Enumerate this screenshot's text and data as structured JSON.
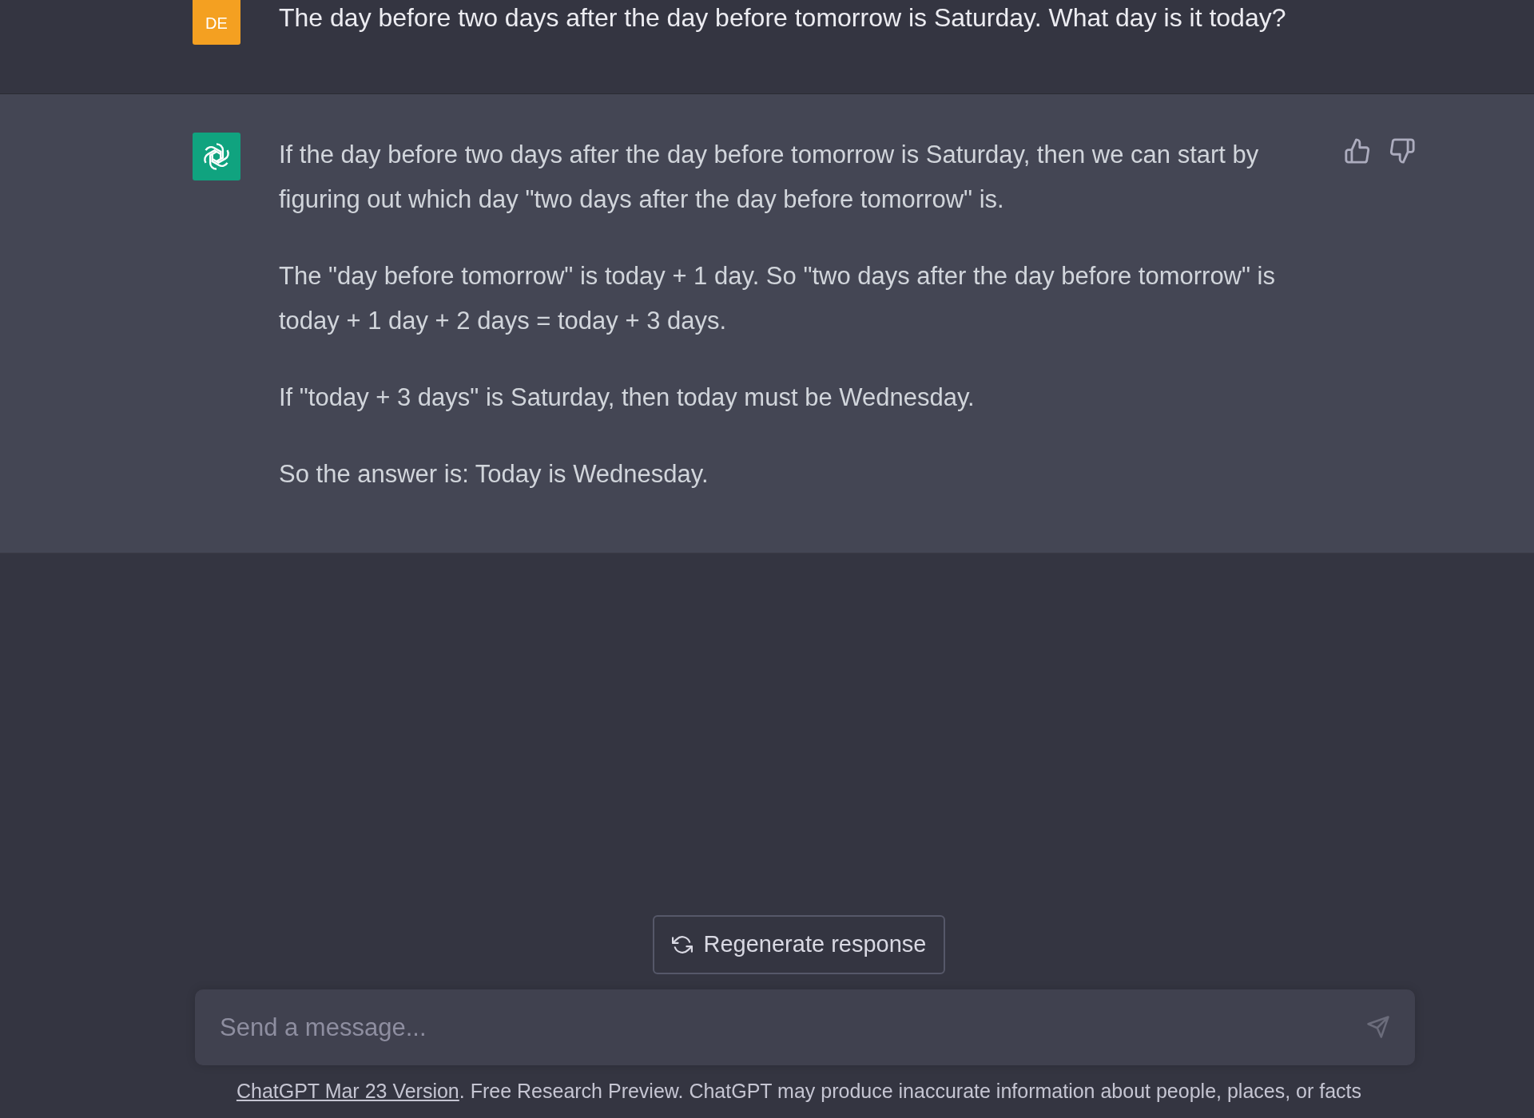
{
  "user_message": {
    "avatar": "DE",
    "text": "The day before two days after the day before tomorrow is Saturday. What day is it today?"
  },
  "assistant_message": {
    "paragraphs": [
      "If the day before two days after the day before tomorrow is Saturday, then we can start by figuring out which day \"two days after the day before tomorrow\" is.",
      "The \"day before tomorrow\" is today + 1 day. So \"two days after the day before tomorrow\" is today + 1 day + 2 days = today + 3 days.",
      "If \"today + 3 days\" is Saturday, then today must be Wednesday.",
      "So the answer is: Today is Wednesday."
    ]
  },
  "regenerate_button": {
    "label": "Regenerate response"
  },
  "composer": {
    "placeholder": "Send a message..."
  },
  "footer": {
    "link": "ChatGPT Mar 23 Version",
    "text": ". Free Research Preview. ChatGPT may produce inaccurate information about people, places, or facts"
  }
}
